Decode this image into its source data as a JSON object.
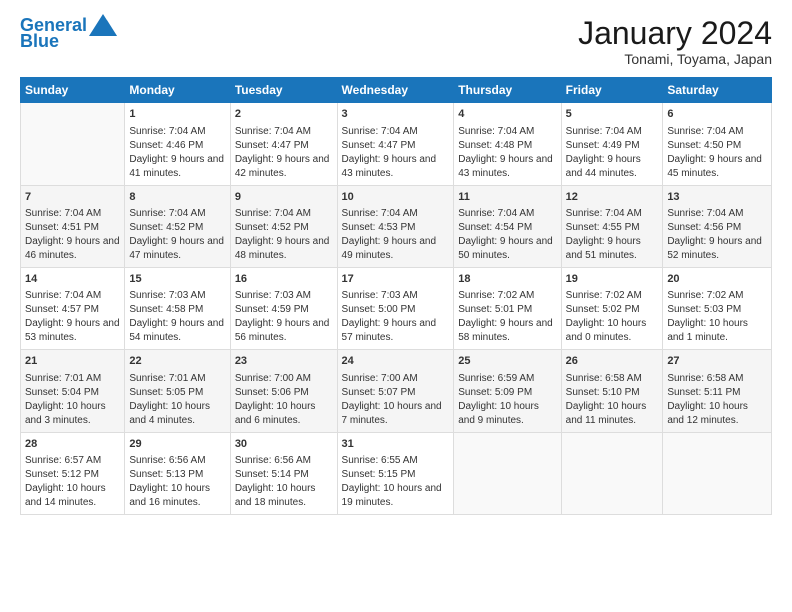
{
  "header": {
    "logo_line1": "General",
    "logo_line2": "Blue",
    "month_title": "January 2024",
    "location": "Tonami, Toyama, Japan"
  },
  "days_of_week": [
    "Sunday",
    "Monday",
    "Tuesday",
    "Wednesday",
    "Thursday",
    "Friday",
    "Saturday"
  ],
  "weeks": [
    [
      {
        "day": "",
        "sunrise": "",
        "sunset": "",
        "daylight": ""
      },
      {
        "day": "1",
        "sunrise": "Sunrise: 7:04 AM",
        "sunset": "Sunset: 4:46 PM",
        "daylight": "Daylight: 9 hours and 41 minutes."
      },
      {
        "day": "2",
        "sunrise": "Sunrise: 7:04 AM",
        "sunset": "Sunset: 4:47 PM",
        "daylight": "Daylight: 9 hours and 42 minutes."
      },
      {
        "day": "3",
        "sunrise": "Sunrise: 7:04 AM",
        "sunset": "Sunset: 4:47 PM",
        "daylight": "Daylight: 9 hours and 43 minutes."
      },
      {
        "day": "4",
        "sunrise": "Sunrise: 7:04 AM",
        "sunset": "Sunset: 4:48 PM",
        "daylight": "Daylight: 9 hours and 43 minutes."
      },
      {
        "day": "5",
        "sunrise": "Sunrise: 7:04 AM",
        "sunset": "Sunset: 4:49 PM",
        "daylight": "Daylight: 9 hours and 44 minutes."
      },
      {
        "day": "6",
        "sunrise": "Sunrise: 7:04 AM",
        "sunset": "Sunset: 4:50 PM",
        "daylight": "Daylight: 9 hours and 45 minutes."
      }
    ],
    [
      {
        "day": "7",
        "sunrise": "Sunrise: 7:04 AM",
        "sunset": "Sunset: 4:51 PM",
        "daylight": "Daylight: 9 hours and 46 minutes."
      },
      {
        "day": "8",
        "sunrise": "Sunrise: 7:04 AM",
        "sunset": "Sunset: 4:52 PM",
        "daylight": "Daylight: 9 hours and 47 minutes."
      },
      {
        "day": "9",
        "sunrise": "Sunrise: 7:04 AM",
        "sunset": "Sunset: 4:52 PM",
        "daylight": "Daylight: 9 hours and 48 minutes."
      },
      {
        "day": "10",
        "sunrise": "Sunrise: 7:04 AM",
        "sunset": "Sunset: 4:53 PM",
        "daylight": "Daylight: 9 hours and 49 minutes."
      },
      {
        "day": "11",
        "sunrise": "Sunrise: 7:04 AM",
        "sunset": "Sunset: 4:54 PM",
        "daylight": "Daylight: 9 hours and 50 minutes."
      },
      {
        "day": "12",
        "sunrise": "Sunrise: 7:04 AM",
        "sunset": "Sunset: 4:55 PM",
        "daylight": "Daylight: 9 hours and 51 minutes."
      },
      {
        "day": "13",
        "sunrise": "Sunrise: 7:04 AM",
        "sunset": "Sunset: 4:56 PM",
        "daylight": "Daylight: 9 hours and 52 minutes."
      }
    ],
    [
      {
        "day": "14",
        "sunrise": "Sunrise: 7:04 AM",
        "sunset": "Sunset: 4:57 PM",
        "daylight": "Daylight: 9 hours and 53 minutes."
      },
      {
        "day": "15",
        "sunrise": "Sunrise: 7:03 AM",
        "sunset": "Sunset: 4:58 PM",
        "daylight": "Daylight: 9 hours and 54 minutes."
      },
      {
        "day": "16",
        "sunrise": "Sunrise: 7:03 AM",
        "sunset": "Sunset: 4:59 PM",
        "daylight": "Daylight: 9 hours and 56 minutes."
      },
      {
        "day": "17",
        "sunrise": "Sunrise: 7:03 AM",
        "sunset": "Sunset: 5:00 PM",
        "daylight": "Daylight: 9 hours and 57 minutes."
      },
      {
        "day": "18",
        "sunrise": "Sunrise: 7:02 AM",
        "sunset": "Sunset: 5:01 PM",
        "daylight": "Daylight: 9 hours and 58 minutes."
      },
      {
        "day": "19",
        "sunrise": "Sunrise: 7:02 AM",
        "sunset": "Sunset: 5:02 PM",
        "daylight": "Daylight: 10 hours and 0 minutes."
      },
      {
        "day": "20",
        "sunrise": "Sunrise: 7:02 AM",
        "sunset": "Sunset: 5:03 PM",
        "daylight": "Daylight: 10 hours and 1 minute."
      }
    ],
    [
      {
        "day": "21",
        "sunrise": "Sunrise: 7:01 AM",
        "sunset": "Sunset: 5:04 PM",
        "daylight": "Daylight: 10 hours and 3 minutes."
      },
      {
        "day": "22",
        "sunrise": "Sunrise: 7:01 AM",
        "sunset": "Sunset: 5:05 PM",
        "daylight": "Daylight: 10 hours and 4 minutes."
      },
      {
        "day": "23",
        "sunrise": "Sunrise: 7:00 AM",
        "sunset": "Sunset: 5:06 PM",
        "daylight": "Daylight: 10 hours and 6 minutes."
      },
      {
        "day": "24",
        "sunrise": "Sunrise: 7:00 AM",
        "sunset": "Sunset: 5:07 PM",
        "daylight": "Daylight: 10 hours and 7 minutes."
      },
      {
        "day": "25",
        "sunrise": "Sunrise: 6:59 AM",
        "sunset": "Sunset: 5:09 PM",
        "daylight": "Daylight: 10 hours and 9 minutes."
      },
      {
        "day": "26",
        "sunrise": "Sunrise: 6:58 AM",
        "sunset": "Sunset: 5:10 PM",
        "daylight": "Daylight: 10 hours and 11 minutes."
      },
      {
        "day": "27",
        "sunrise": "Sunrise: 6:58 AM",
        "sunset": "Sunset: 5:11 PM",
        "daylight": "Daylight: 10 hours and 12 minutes."
      }
    ],
    [
      {
        "day": "28",
        "sunrise": "Sunrise: 6:57 AM",
        "sunset": "Sunset: 5:12 PM",
        "daylight": "Daylight: 10 hours and 14 minutes."
      },
      {
        "day": "29",
        "sunrise": "Sunrise: 6:56 AM",
        "sunset": "Sunset: 5:13 PM",
        "daylight": "Daylight: 10 hours and 16 minutes."
      },
      {
        "day": "30",
        "sunrise": "Sunrise: 6:56 AM",
        "sunset": "Sunset: 5:14 PM",
        "daylight": "Daylight: 10 hours and 18 minutes."
      },
      {
        "day": "31",
        "sunrise": "Sunrise: 6:55 AM",
        "sunset": "Sunset: 5:15 PM",
        "daylight": "Daylight: 10 hours and 19 minutes."
      },
      {
        "day": "",
        "sunrise": "",
        "sunset": "",
        "daylight": ""
      },
      {
        "day": "",
        "sunrise": "",
        "sunset": "",
        "daylight": ""
      },
      {
        "day": "",
        "sunrise": "",
        "sunset": "",
        "daylight": ""
      }
    ]
  ]
}
